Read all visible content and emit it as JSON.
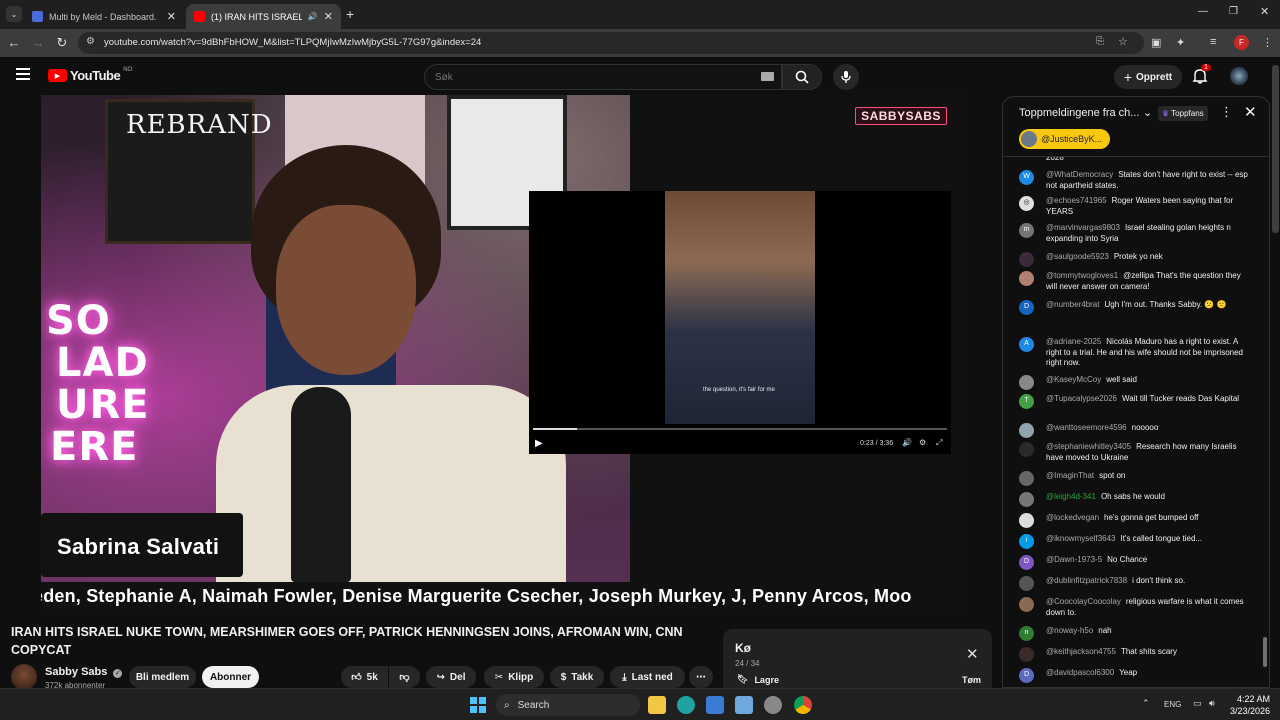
{
  "browser": {
    "tabs": [
      {
        "title": "Multi by Meld - Dashboard.",
        "active": false,
        "favicon_color": "#4a6bd8"
      },
      {
        "title": "(1) IRAN HITS ISRAEL NUKE",
        "active": true,
        "favicon_color": "#ff0000"
      }
    ],
    "new_tab_icon": "plus-icon",
    "url": "youtube.com/watch?v=9dBhFbHOW_M&list=TLPQMjIwMzIwMjbyG5L-77G97g&index=24",
    "profile_initial": "F"
  },
  "youtube": {
    "logo_text": "YouTube",
    "region": "NO",
    "search_placeholder": "Søk",
    "create_label": "Opprett",
    "notification_count": "1",
    "brand_red": "#ff0000"
  },
  "video": {
    "board_text": "REBRAND",
    "neon_lines": [
      "SO",
      "LAD",
      "URE",
      "ERE"
    ],
    "channel_logo": "SABBYSABS",
    "lower_third_name": "Sabrina Salvati",
    "ticker_text": "eden, Stephanie A, Naimah Fowler, Denise Marguerite Csecher, Joseph Murkey, J, Penny Arcos, Moo",
    "inset_subtitle": "the question, it's fair for me",
    "inset_time": "0:23 / 3:36",
    "inset_progress": 0.107
  },
  "details": {
    "title": "IRAN HITS ISRAEL NUKE TOWN, MEARSHIMER GOES OFF, PATRICK HENNINGSEN JOINS, AFROMAN WIN, CNN COPYCAT",
    "channel": "Sabby Sabs",
    "subscribers": "372k abonnenter",
    "join_label": "Bli medlem",
    "subscribe_label": "Abonner",
    "likes": "5k",
    "share_label": "Del",
    "clip_label": "Klipp",
    "thanks_label": "Takk",
    "download_label": "Last ned"
  },
  "queue": {
    "title": "Kø",
    "count": "24 / 34",
    "save_label": "Lagre",
    "clear_label": "Tøm"
  },
  "chat": {
    "title": "Toppmeldingene fra ch...",
    "toppfans_label": "Toppfans",
    "pinned_user": "@JusticeByK...",
    "messages": [
      {
        "author": "",
        "text": "2028",
        "av": "",
        "color": "#555"
      },
      {
        "author": "@WhatDemocracy",
        "text": "States don't have right to exist -- esp not apartheid states.",
        "av": "W",
        "color": "#1e88e5"
      },
      {
        "author": "@echoes741965",
        "text": "Roger Waters been saying that for YEARS",
        "av": "◎",
        "color": "#e0e0e0"
      },
      {
        "author": "@marvinvargas9803",
        "text": "Israel stealing golan heights n expanding into Syria",
        "av": "m",
        "color": "#757575"
      },
      {
        "author": "@saulgoode5923",
        "text": "Protek yo nek",
        "av": "",
        "color": "#3a2a3a"
      },
      {
        "author": "@tommytwogloves1",
        "text": "@zellipa That's the question they will never answer on camera!",
        "av": "",
        "color": "#b08070"
      },
      {
        "author": "@number4brat",
        "text": "Ugh I'm out. Thanks Sabby. 🙁 🙁",
        "av": "D",
        "color": "#1565c0"
      },
      {
        "author": "@adriane-2025",
        "text": "Nicolás Maduro has a right to exist. A right to a trial. He and his wife should not be imprisoned right now.",
        "av": "A",
        "color": "#1e88e5"
      },
      {
        "author": "@KaseyMcCoy",
        "text": "well said",
        "av": "",
        "color": "#888"
      },
      {
        "author": "@Tupacalypse2026",
        "text": "Wait till Tucker reads Das Kapital",
        "av": "T",
        "color": "#43a047"
      },
      {
        "author": "@wanttoseemore4596",
        "text": "nooooo",
        "av": "",
        "color": "#90a4ae"
      },
      {
        "author": "@stephaniewhitley3405",
        "text": "Research how many Israelis have moved to Ukraine",
        "av": "",
        "color": "#2a2a2a"
      },
      {
        "author": "@ImaginThat",
        "text": "spot on",
        "av": "",
        "color": "#666"
      },
      {
        "author": "@leigh4d-341",
        "text": "Oh sabs he would",
        "av": "",
        "color": "#777",
        "green": true
      },
      {
        "author": "@lockedvegan",
        "text": "he's gonna get bumped off",
        "av": "",
        "color": "#ddd"
      },
      {
        "author": "@iknowmyself3643",
        "text": "It's called tongue tied...",
        "av": "i",
        "color": "#039be5"
      },
      {
        "author": "@Dawn-1973-5",
        "text": "No Chance",
        "av": "D",
        "color": "#7e57c2"
      },
      {
        "author": "@dublinfitzpatrick7838",
        "text": "i don't think so.",
        "av": "",
        "color": "#555"
      },
      {
        "author": "@CoocolayCoocolay",
        "text": "religious warfare is what it comes down to.",
        "av": "",
        "color": "#8a6a50"
      },
      {
        "author": "@noway-h5o",
        "text": "nah",
        "av": "n",
        "color": "#2e7d32"
      },
      {
        "author": "@keithjackson4755",
        "text": "That shits scary",
        "av": "",
        "color": "#3a2a2a"
      },
      {
        "author": "@davidpascol6300",
        "text": "Yeap",
        "av": "D",
        "color": "#5c6bc0"
      }
    ]
  },
  "taskbar": {
    "search_label": "Search",
    "lang": "ENG",
    "time": "4:22 AM",
    "date": "3/23/2026"
  }
}
